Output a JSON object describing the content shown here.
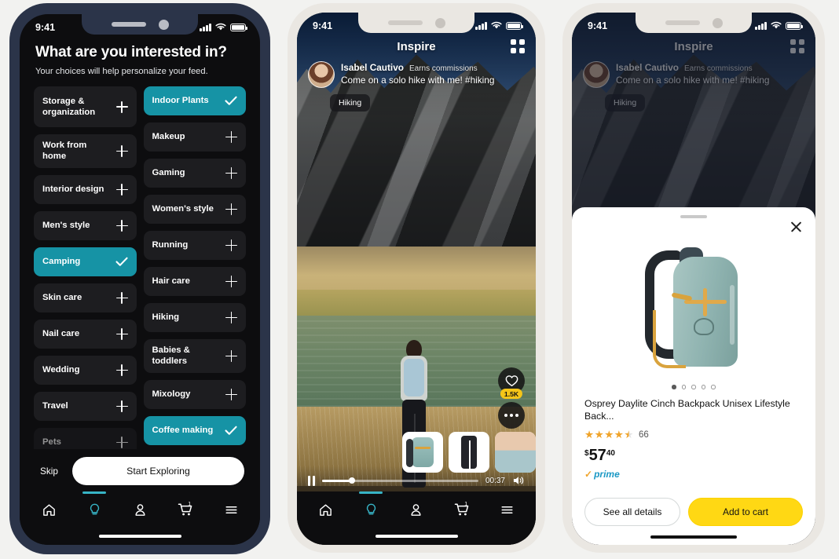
{
  "status_bar": {
    "time": "9:41",
    "signal_icon": "cellular-bars-icon",
    "wifi_icon": "wifi-icon",
    "battery_icon": "battery-full-icon"
  },
  "phone1": {
    "title": "What are you interested in?",
    "subtitle": "Your choices will help personalize your feed.",
    "left_column": [
      {
        "label": "Storage & organization",
        "selected": false
      },
      {
        "label": "Work from home",
        "selected": false
      },
      {
        "label": "Interior design",
        "selected": false
      },
      {
        "label": "Men's style",
        "selected": false
      },
      {
        "label": "Camping",
        "selected": true
      },
      {
        "label": "Skin care",
        "selected": false
      },
      {
        "label": "Nail care",
        "selected": false
      },
      {
        "label": "Wedding",
        "selected": false
      },
      {
        "label": "Travel",
        "selected": false
      },
      {
        "label": "Pets",
        "selected": false
      }
    ],
    "right_column": [
      {
        "label": "Indoor Plants",
        "selected": true
      },
      {
        "label": "Makeup",
        "selected": false
      },
      {
        "label": "Gaming",
        "selected": false
      },
      {
        "label": "Women's style",
        "selected": false
      },
      {
        "label": "Running",
        "selected": false
      },
      {
        "label": "Hair care",
        "selected": false
      },
      {
        "label": "Hiking",
        "selected": false
      },
      {
        "label": "Babies & toddlers",
        "selected": false
      },
      {
        "label": "Mixology",
        "selected": false
      },
      {
        "label": "Coffee making",
        "selected": true
      }
    ],
    "skip_label": "Skip",
    "start_label": "Start Exploring",
    "accent_color": "#1693a5"
  },
  "tabbar": {
    "items": [
      {
        "icon": "home-icon",
        "active": false
      },
      {
        "icon": "lightbulb-icon",
        "active": true
      },
      {
        "icon": "person-icon",
        "active": false
      },
      {
        "icon": "cart-icon",
        "active": false,
        "badge": "1"
      },
      {
        "icon": "hamburger-menu-icon",
        "active": false
      }
    ],
    "active_indicator_color": "#37b4c6"
  },
  "feed": {
    "title": "Inspire",
    "grid_icon": "grid-view-icon",
    "creator_name": "Isabel Cautivo",
    "creator_badge": "Earns commissions",
    "caption": "Come on a solo hike with me! #hiking",
    "tag": "Hiking",
    "like_icon": "heart-icon",
    "like_count": "1.5K",
    "more_icon": "ellipsis-icon",
    "player": {
      "pause_icon": "pause-icon",
      "time": "00:37",
      "volume_icon": "volume-on-icon",
      "progress_percent": 19
    },
    "products": [
      {
        "name": "backpack-thumbnail"
      },
      {
        "name": "pants-thumbnail"
      },
      {
        "name": "tank-top-thumbnail"
      }
    ]
  },
  "product_sheet": {
    "close_icon": "close-icon",
    "carousel_dots": 5,
    "carousel_active_index": 0,
    "title": "Osprey Daylite Cinch Backpack Unisex Lifestyle Back...",
    "stars": "★★★★",
    "half_star": "★",
    "rating_value": 4.5,
    "rating_count": "66",
    "price_currency": "$",
    "price_whole": "57",
    "price_fraction": "40",
    "prime_check": "✓",
    "prime_label": "prime",
    "see_details_label": "See all details",
    "add_to_cart_label": "Add to cart",
    "cart_button_color": "#ffd814"
  }
}
